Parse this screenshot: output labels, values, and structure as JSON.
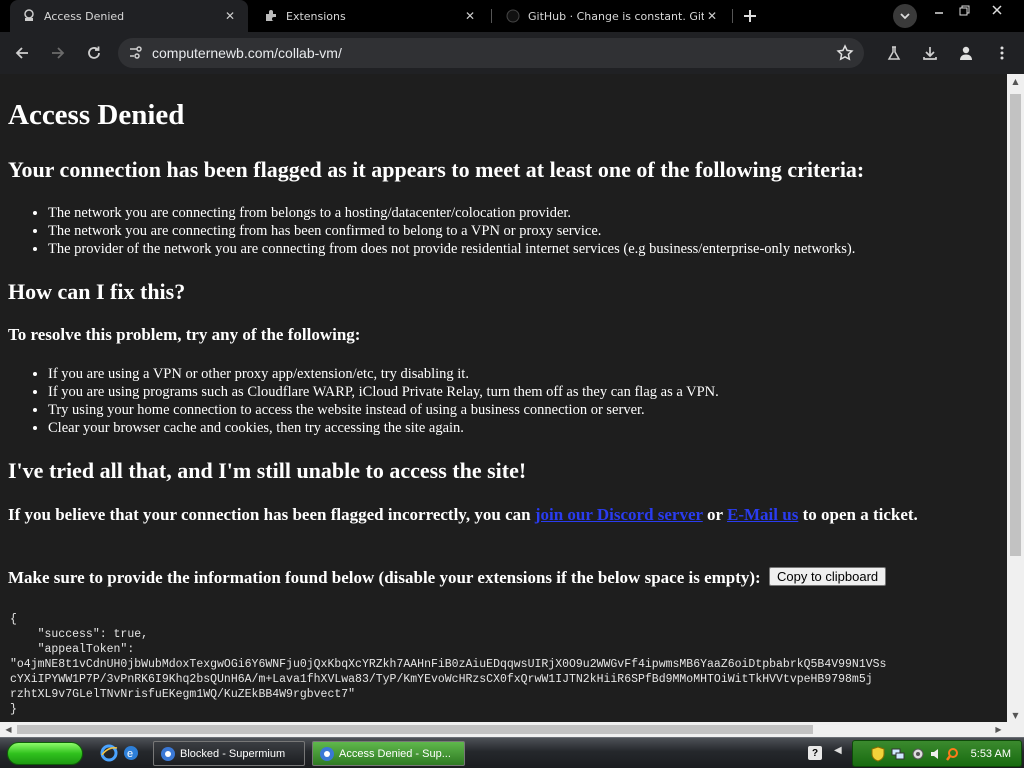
{
  "tabs": [
    {
      "title": "Access Denied",
      "icon": "page-icon",
      "active": true
    },
    {
      "title": "Extensions",
      "icon": "puzzle-icon",
      "active": false
    },
    {
      "title": "GitHub · Change is constant. GitHub",
      "icon": "github-icon",
      "active": false
    }
  ],
  "omnibox": {
    "url": "computernewb.com/collab-vm/"
  },
  "page": {
    "title": "Access Denied",
    "criteria_heading": "Your connection has been flagged as it appears to meet at least one of the following criteria:",
    "criteria": [
      "The network you are connecting from belongs to a hosting/datacenter/colocation provider.",
      "The network you are connecting from has been confirmed to belong to a VPN or proxy service.",
      "The provider of the network you are connecting from does not provide residential internet services (e.g business/enterprise-only networks)."
    ],
    "fix_heading": "How can I fix this?",
    "resolve_heading": "To resolve this problem, try any of the following:",
    "fixes": [
      "If you are using a VPN or other proxy app/extension/etc, try disabling it.",
      "If you are using programs such as Cloudflare WARP, iCloud Private Relay, turn them off as they can flag as a VPN.",
      "Try using your home connection to access the website instead of using a business connection or server.",
      "Clear your browser cache and cookies, then try accessing the site again."
    ],
    "tried_heading": "I've tried all that, and I'm still unable to access the site!",
    "ticket_pre": "If you believe that your connection has been flagged incorrectly, you can ",
    "discord_link": "join our Discord server",
    "ticket_or": " or ",
    "email_link": "E-Mail us",
    "ticket_post": " to open a ticket.",
    "provide_text": "Make sure to provide the information found below (disable your extensions if the below space is empty):",
    "copy_button": "Copy to clipboard",
    "json_lines": [
      "{",
      "    \"success\": true,",
      "    \"appealToken\":",
      "\"o4jmNE8t1vCdnUH0jbWubMdoxTexgwOGi6Y6WNFju0jQxKbqXcYRZkh7AAHnFiB0zAiuEDqqwsUIRjX0O9u2WWGvFf4ipwmsMB6YaaZ6oiDtpbabrkQ5B4V99N1VSs",
      "cYXiIPYWW1P7P/3vPnRK6I9Khq2bsQUnH6A/m+Lava1fhXVLwa83/TyP/KmYEvoWcHRzsCX0fxQrwW1IJTN2kHiiR6SPfBd9MMoMHTOiWitTkHVVtvpeHB9798m5j",
      "rzhtXL9v7GLelTNvNrisfuEKegm1WQ/KuZEkBB4W9rgbvect7\"",
      "}"
    ]
  },
  "taskbar": {
    "items": [
      {
        "label": "Blocked - Supermium",
        "active": false
      },
      {
        "label": "Access Denied - Sup...",
        "active": true
      }
    ],
    "clock": "5:53 AM",
    "help": "?"
  },
  "colors": {
    "link": "#2a3cf0",
    "page_bg": "#1e1e1e",
    "tray": "#2f7f22"
  }
}
